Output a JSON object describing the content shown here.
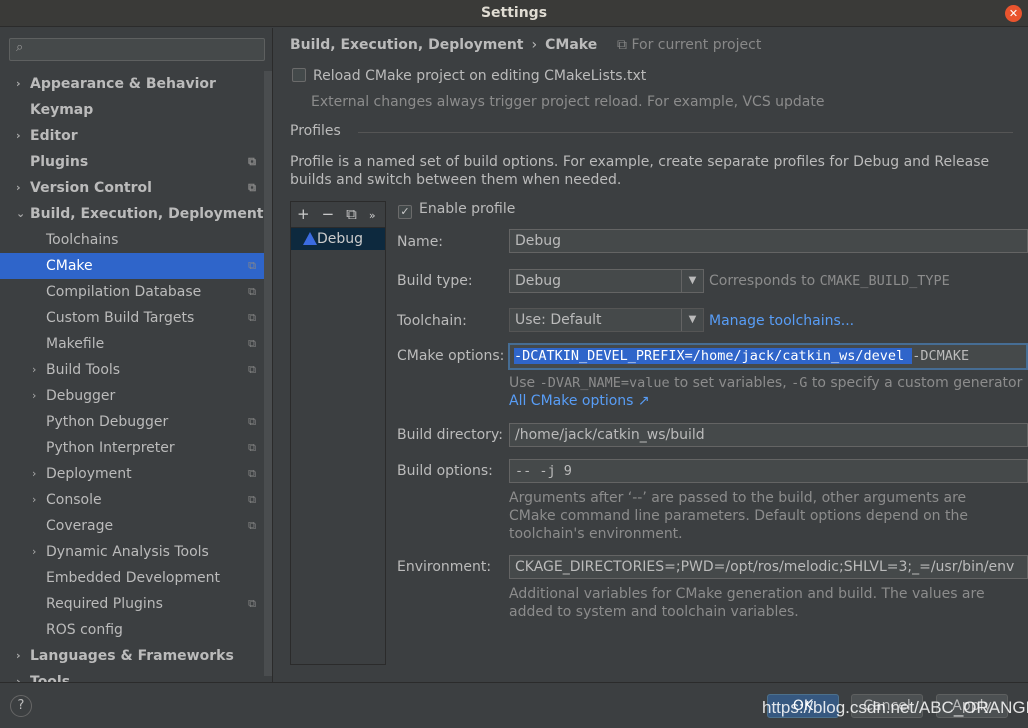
{
  "window": {
    "title": "Settings"
  },
  "sidebar": {
    "search_placeholder": "",
    "items": [
      {
        "label": "Appearance & Behavior",
        "level": 0,
        "bold": true,
        "arrow": "›",
        "proj": false
      },
      {
        "label": "Keymap",
        "level": 0,
        "bold": true,
        "arrow": "",
        "proj": false
      },
      {
        "label": "Editor",
        "level": 0,
        "bold": true,
        "arrow": "›",
        "proj": false
      },
      {
        "label": "Plugins",
        "level": 0,
        "bold": true,
        "arrow": "",
        "proj": true
      },
      {
        "label": "Version Control",
        "level": 0,
        "bold": true,
        "arrow": "›",
        "proj": true
      },
      {
        "label": "Build, Execution, Deployment",
        "level": 0,
        "bold": true,
        "arrow": "⌄",
        "proj": false
      },
      {
        "label": "Toolchains",
        "level": 1,
        "arrow": "",
        "proj": false
      },
      {
        "label": "CMake",
        "level": 1,
        "arrow": "",
        "proj": true,
        "selected": true
      },
      {
        "label": "Compilation Database",
        "level": 1,
        "arrow": "",
        "proj": true
      },
      {
        "label": "Custom Build Targets",
        "level": 1,
        "arrow": "",
        "proj": true
      },
      {
        "label": "Makefile",
        "level": 1,
        "arrow": "",
        "proj": true
      },
      {
        "label": "Build Tools",
        "level": 1,
        "arrow": "›",
        "proj": true
      },
      {
        "label": "Debugger",
        "level": 1,
        "arrow": "›",
        "proj": false
      },
      {
        "label": "Python Debugger",
        "level": 1,
        "arrow": "",
        "proj": true
      },
      {
        "label": "Python Interpreter",
        "level": 1,
        "arrow": "",
        "proj": true
      },
      {
        "label": "Deployment",
        "level": 1,
        "arrow": "›",
        "proj": true
      },
      {
        "label": "Console",
        "level": 1,
        "arrow": "›",
        "proj": true
      },
      {
        "label": "Coverage",
        "level": 1,
        "arrow": "",
        "proj": true
      },
      {
        "label": "Dynamic Analysis Tools",
        "level": 1,
        "arrow": "›",
        "proj": false
      },
      {
        "label": "Embedded Development",
        "level": 1,
        "arrow": "",
        "proj": false
      },
      {
        "label": "Required Plugins",
        "level": 1,
        "arrow": "",
        "proj": true
      },
      {
        "label": "ROS config",
        "level": 1,
        "arrow": "",
        "proj": false
      },
      {
        "label": "Languages & Frameworks",
        "level": 0,
        "bold": true,
        "arrow": "›",
        "proj": false
      },
      {
        "label": "Tools",
        "level": 0,
        "bold": true,
        "arrow": "›",
        "proj": false
      }
    ]
  },
  "header": {
    "crumb1": "Build, Execution, Deployment",
    "sep": "›",
    "crumb2": "CMake",
    "for_project": "⧉ For current project"
  },
  "reload": {
    "label": "Reload CMake project on editing CMakeLists.txt",
    "checked": false,
    "hint": "External changes always trigger project reload. For example, VCS update"
  },
  "profiles": {
    "title": "Profiles",
    "desc1": "Profile is a named set of build options. For example, create separate profiles for Debug and Release",
    "desc2": "builds and switch between them when needed.",
    "toolbar": {
      "add": "+",
      "remove": "−",
      "copy": "⧉",
      "more": "»"
    },
    "list": [
      "Debug"
    ]
  },
  "form": {
    "enable_label": "Enable profile",
    "enable_checked": true,
    "name_label": "Name:",
    "name_value": "Debug",
    "build_type_label": "Build type:",
    "build_type_value": "Debug",
    "build_type_hint_pre": "Corresponds to ",
    "build_type_hint_code": "CMAKE_BUILD_TYPE",
    "toolchain_label": "Toolchain:",
    "toolchain_value": "Use: Default",
    "manage_link": "Manage toolchains...",
    "cmake_label": "CMake options:",
    "cmake_selected": "-DCATKIN_DEVEL_PREFIX=/home/jack/catkin_ws/devel ",
    "cmake_rest": " -DCMAKE",
    "cmake_hint_1": "Use ",
    "cmake_hint_2": "-DVAR_NAME=value",
    "cmake_hint_3": " to set variables, ",
    "cmake_hint_4": "-G",
    "cmake_hint_5": " to specify a custom generator",
    "all_options_link": "All CMake options ↗",
    "build_dir_label": "Build directory:",
    "build_dir_value": "/home/jack/catkin_ws/build",
    "build_opts_label": "Build options:",
    "build_opts_placeholder": "-- -j 9",
    "build_opts_hint1": "Arguments after ‘--’ are passed to the build, other arguments are",
    "build_opts_hint2": "CMake command line parameters. Default options depend on the",
    "build_opts_hint3": "toolchain's environment.",
    "env_label": "Environment:",
    "env_value": "CKAGE_DIRECTORIES=;PWD=/opt/ros/melodic;SHLVL=3;_=/usr/bin/env",
    "env_hint1": "Additional variables for CMake generation and build. The values are",
    "env_hint2": "added to system and toolchain variables."
  },
  "footer": {
    "help": "?",
    "ok": "OK",
    "cancel": "Cancel",
    "apply": "Apply"
  },
  "watermark": "https://blog.csdn.net/ABC_ORANGE",
  "colors": {
    "accent": "#2f65ca",
    "link": "#589df6",
    "background": "#3c3f41"
  }
}
